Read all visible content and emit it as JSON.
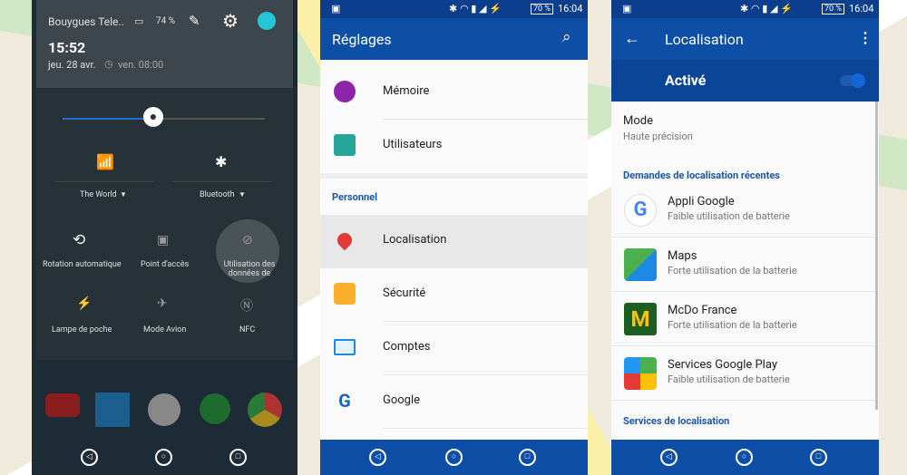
{
  "left": {
    "carrier": "Bouygues Tele..",
    "battery": "74 %",
    "time": "15:52",
    "date": "jeu. 28 avr.",
    "alarm": "ven. 08:00",
    "brightness": 0.45,
    "wifi_label": "The World",
    "bt_label": "Bluetooth",
    "tiles": [
      "Rotation automatique",
      "Point d'accès",
      "Utilisation des données de",
      "Lampe de poche",
      "Mode Avion",
      "NFC"
    ]
  },
  "middle": {
    "status_time": "16:04",
    "battery": "70 %",
    "title": "Réglages",
    "section": "Personnel",
    "items": [
      {
        "label": "Mémoire",
        "icon": "memory-icon"
      },
      {
        "label": "Utilisateurs",
        "icon": "users-icon"
      },
      {
        "label": "Localisation",
        "icon": "location-pin-icon"
      },
      {
        "label": "Sécurité",
        "icon": "lock-icon"
      },
      {
        "label": "Comptes",
        "icon": "account-card-icon"
      },
      {
        "label": "Google",
        "icon": "google-icon"
      }
    ]
  },
  "right": {
    "status_time": "16:04",
    "battery": "70 %",
    "title": "Localisation",
    "toggle_label": "Activé",
    "toggle_on": true,
    "mode_label": "Mode",
    "mode_value": "Haute précision",
    "recent_header": "Demandes de localisation récentes",
    "apps": [
      {
        "name": "Appli Google",
        "sub": "Faible utilisation de batterie"
      },
      {
        "name": "Maps",
        "sub": "Forte utilisation de la batterie"
      },
      {
        "name": "McDo France",
        "sub": "Forte utilisation de la batterie"
      },
      {
        "name": "Services Google Play",
        "sub": "Faible utilisation de batterie"
      }
    ],
    "services_header": "Services de localisation"
  },
  "colors": {
    "primary": "#0d4ea6",
    "status": "#0b3f8e",
    "accent": "#1a56a8"
  }
}
